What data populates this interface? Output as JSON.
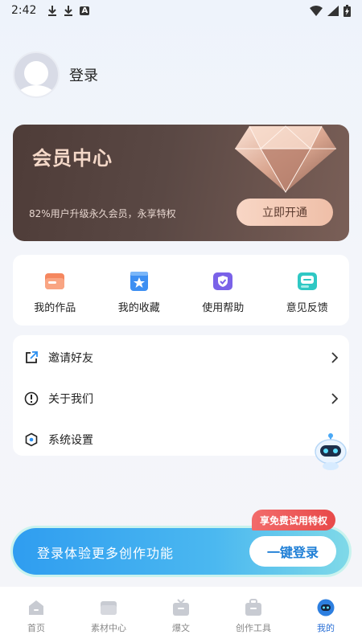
{
  "status_bar": {
    "time": "2:42",
    "badge": "A"
  },
  "profile": {
    "login_label": "登录"
  },
  "vip": {
    "title": "会员中心",
    "description": "82%用户升级永久会员，永享特权",
    "button_label": "立即开通",
    "colors": {
      "card": "#4e3c38",
      "button": "#f8d6c5"
    }
  },
  "quick_actions": [
    {
      "label": "我的作品",
      "icon": "folder-icon",
      "color": "#f5875f"
    },
    {
      "label": "我的收藏",
      "icon": "star-icon",
      "color": "#3d8ff2"
    },
    {
      "label": "使用帮助",
      "icon": "shield-help-icon",
      "color": "#7a62e8"
    },
    {
      "label": "意见反馈",
      "icon": "feedback-icon",
      "color": "#2fc8c4"
    }
  ],
  "menu": [
    {
      "label": "邀请好友",
      "icon": "share-icon"
    },
    {
      "label": "关于我们",
      "icon": "info-icon"
    },
    {
      "label": "系统设置",
      "icon": "settings-icon"
    }
  ],
  "promo": {
    "tag": "享免费试用特权",
    "banner_text": "登录体验更多创作功能",
    "button_label": "一键登录"
  },
  "tabs": [
    {
      "label": "首页",
      "icon": "home-icon",
      "active": false
    },
    {
      "label": "素材中心",
      "icon": "folder-icon",
      "active": false
    },
    {
      "label": "爆文",
      "icon": "tv-icon",
      "active": false
    },
    {
      "label": "创作工具",
      "icon": "toolbox-icon",
      "active": false
    },
    {
      "label": "我的",
      "icon": "robot-face-icon",
      "active": true
    }
  ]
}
